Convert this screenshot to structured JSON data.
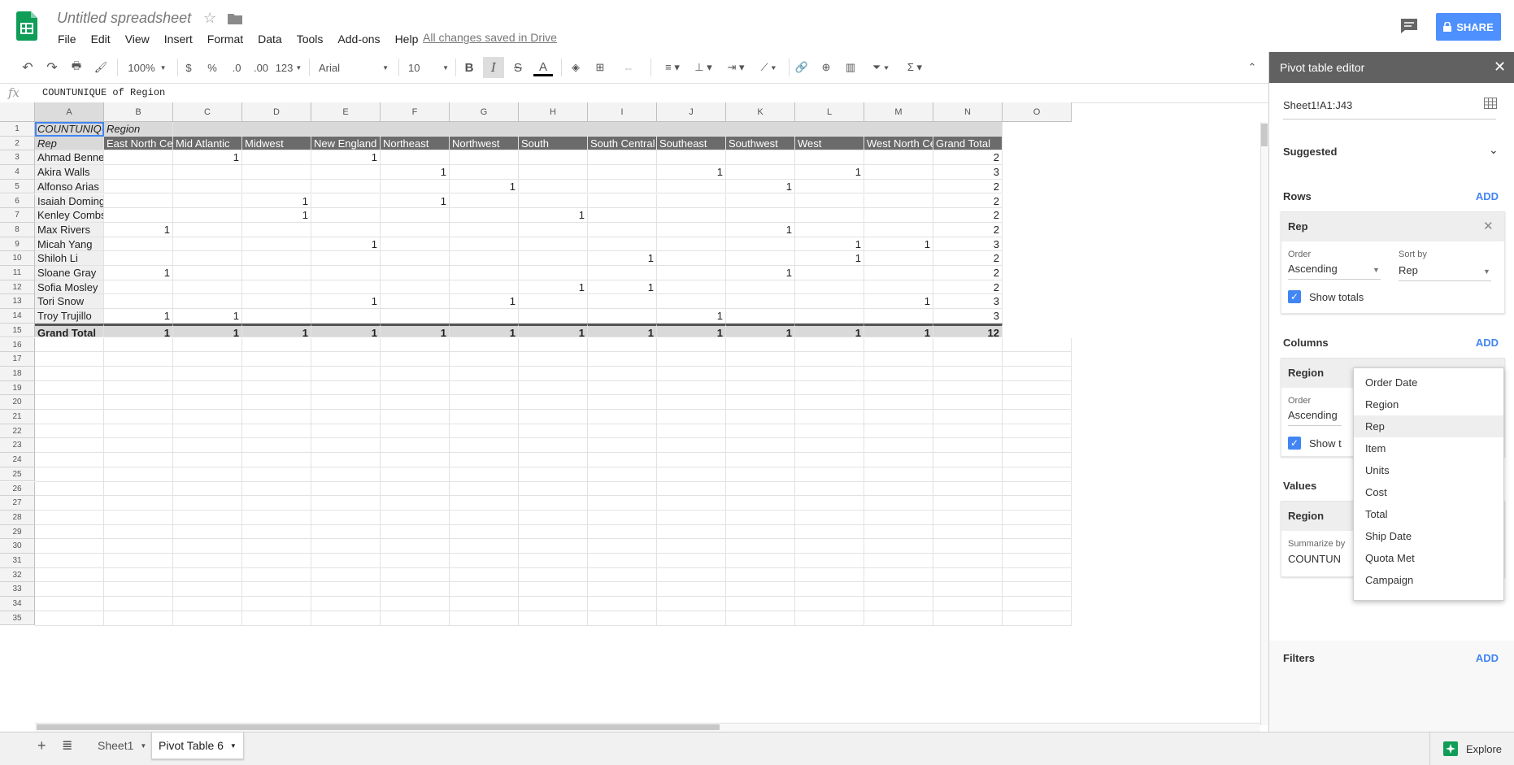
{
  "app": {
    "title": "Untitled spreadsheet",
    "save_status": "All changes saved in Drive",
    "share_label": "SHARE",
    "menu": [
      "File",
      "Edit",
      "View",
      "Insert",
      "Format",
      "Data",
      "Tools",
      "Add-ons",
      "Help"
    ],
    "accent": "#4d90fe",
    "brand": "#0f9d58"
  },
  "toolbar": {
    "zoom": "100%",
    "currency": "$",
    "percent": "%",
    "dec_decrease": ".0",
    "dec_increase": ".00",
    "format_more": "123",
    "font": "Arial",
    "font_size": "10",
    "bold": "B",
    "italic": "I",
    "strike": "S",
    "text_color": "A"
  },
  "formula": {
    "fx": "fx",
    "value": "COUNTUNIQUE of Region"
  },
  "grid": {
    "columns": [
      "A",
      "B",
      "C",
      "D",
      "E",
      "F",
      "G",
      "H",
      "I",
      "J",
      "K",
      "L",
      "M",
      "N",
      "O"
    ],
    "rows": [
      "1",
      "2",
      "3",
      "4",
      "5",
      "6",
      "7",
      "8",
      "9",
      "10",
      "11",
      "12",
      "13",
      "14",
      "15",
      "16",
      "17",
      "18",
      "19",
      "20",
      "21",
      "22",
      "23",
      "24",
      "25",
      "26",
      "27",
      "28",
      "29",
      "30",
      "31",
      "32",
      "33",
      "34",
      "35"
    ],
    "r1": {
      "a": "COUNTUNIQUE of Region",
      "b": "Region"
    },
    "r2": [
      "Rep",
      "East North Central",
      "Mid Atlantic",
      "Midwest",
      "New England",
      "Northeast",
      "Northwest",
      "South",
      "South Central",
      "Southeast",
      "Southwest",
      "West",
      "West North Central",
      "Grand Total"
    ],
    "data": [
      {
        "name": "Ahmad Bennett",
        "vals": [
          "",
          "1",
          "",
          "1",
          "",
          "",
          "",
          "",
          "",
          "",
          "",
          "",
          ""
        ],
        "total": "2"
      },
      {
        "name": "Akira Walls",
        "vals": [
          "",
          "",
          "",
          "",
          "1",
          "",
          "",
          "",
          "1",
          "",
          "1",
          "",
          ""
        ],
        "total": "3"
      },
      {
        "name": "Alfonso Arias",
        "vals": [
          "",
          "",
          "",
          "",
          "",
          "1",
          "",
          "",
          "",
          "1",
          "",
          "",
          ""
        ],
        "total": "2"
      },
      {
        "name": "Isaiah Dominguez",
        "vals": [
          "",
          "",
          "1",
          "",
          "1",
          "",
          "",
          "",
          "",
          "",
          "",
          "",
          ""
        ],
        "total": "2"
      },
      {
        "name": "Kenley Combs",
        "vals": [
          "",
          "",
          "1",
          "",
          "",
          "",
          "1",
          "",
          "",
          "",
          "",
          "",
          ""
        ],
        "total": "2"
      },
      {
        "name": "Max Rivers",
        "vals": [
          "1",
          "",
          "",
          "",
          "",
          "",
          "",
          "",
          "",
          "1",
          "",
          "",
          ""
        ],
        "total": "2"
      },
      {
        "name": "Micah Yang",
        "vals": [
          "",
          "",
          "",
          "1",
          "",
          "",
          "",
          "",
          "",
          "",
          "1",
          "1",
          ""
        ],
        "total": "3"
      },
      {
        "name": "Shiloh Li",
        "vals": [
          "",
          "",
          "",
          "",
          "",
          "",
          "",
          "1",
          "",
          "",
          "1",
          "",
          ""
        ],
        "total": "2"
      },
      {
        "name": "Sloane Gray",
        "vals": [
          "1",
          "",
          "",
          "",
          "",
          "",
          "",
          "",
          "",
          "1",
          "",
          "",
          ""
        ],
        "total": "2"
      },
      {
        "name": "Sofia Mosley",
        "vals": [
          "",
          "",
          "",
          "",
          "",
          "",
          "1",
          "1",
          "",
          "",
          "",
          "",
          ""
        ],
        "total": "2"
      },
      {
        "name": "Tori Snow",
        "vals": [
          "",
          "",
          "",
          "1",
          "",
          "1",
          "",
          "",
          "",
          "",
          "",
          "1",
          ""
        ],
        "total": "3"
      },
      {
        "name": "Troy Trujillo",
        "vals": [
          "1",
          "1",
          "",
          "",
          "",
          "",
          "",
          "",
          "1",
          "",
          "",
          "",
          ""
        ],
        "total": "3"
      }
    ],
    "grand": {
      "label": "Grand Total",
      "vals": [
        "1",
        "1",
        "1",
        "1",
        "1",
        "1",
        "1",
        "1",
        "1",
        "1",
        "1",
        "1"
      ],
      "total": "12"
    }
  },
  "sheets": {
    "tabs": [
      "Sheet1",
      "Pivot Table 6"
    ],
    "explore": "Explore"
  },
  "panel": {
    "title": "Pivot table editor",
    "range": "Sheet1!A1:J43",
    "suggested": "Suggested",
    "add": "ADD",
    "rows": {
      "title": "Rows",
      "field": "Rep",
      "order_label": "Order",
      "order": "Ascending",
      "sort_label": "Sort by",
      "sort": "Rep",
      "show_totals": "Show totals"
    },
    "columns": {
      "title": "Columns",
      "field": "Region",
      "order_label": "Order",
      "order": "Ascending",
      "show_totals": "Show totals"
    },
    "values": {
      "title": "Values",
      "field": "Region",
      "summarize_label": "Summarize by",
      "summarize": "COUNTUNIQUE"
    },
    "filters": {
      "title": "Filters"
    }
  },
  "dropdown": {
    "items": [
      "Order Date",
      "Region",
      "Rep",
      "Item",
      "Units",
      "Cost",
      "Total",
      "Ship Date",
      "Quota Met",
      "Campaign"
    ],
    "highlighted": "Rep"
  }
}
